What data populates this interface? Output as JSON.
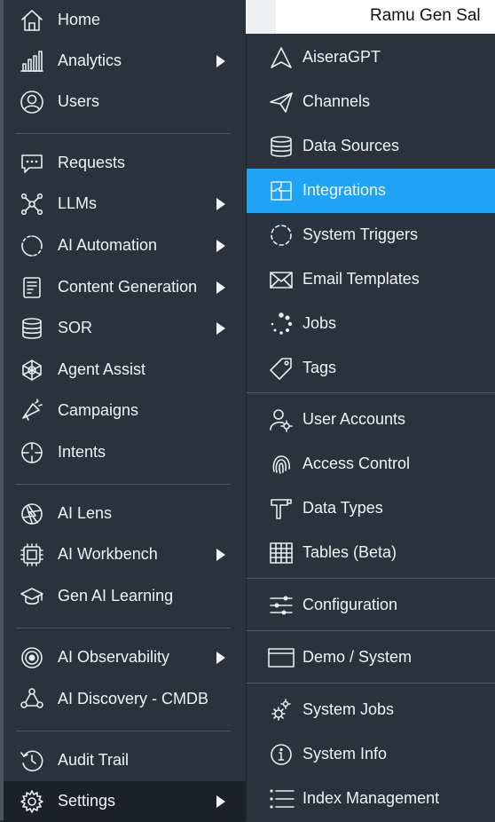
{
  "header": {
    "user_name": "Ramu Gen Sal"
  },
  "left_menu": {
    "items": [
      {
        "label": "Home",
        "icon": "home-icon",
        "has_submenu": false
      },
      {
        "label": "Analytics",
        "icon": "bar-chart-icon",
        "has_submenu": true
      },
      {
        "label": "Users",
        "icon": "user-circle-icon",
        "has_submenu": false
      },
      {
        "label": "Requests",
        "icon": "chat-bubble-icon",
        "has_submenu": false
      },
      {
        "label": "LLMs",
        "icon": "network-icon",
        "has_submenu": true
      },
      {
        "label": "AI Automation",
        "icon": "circle-dots-icon",
        "has_submenu": true
      },
      {
        "label": "Content Generation",
        "icon": "document-icon",
        "has_submenu": true
      },
      {
        "label": "SOR",
        "icon": "database-icon",
        "has_submenu": true
      },
      {
        "label": "Agent Assist",
        "icon": "web-icon",
        "has_submenu": false
      },
      {
        "label": "Campaigns",
        "icon": "megaphone-icon",
        "has_submenu": false
      },
      {
        "label": "Intents",
        "icon": "crosshair-icon",
        "has_submenu": false
      },
      {
        "label": "AI Lens",
        "icon": "aperture-icon",
        "has_submenu": false
      },
      {
        "label": "AI Workbench",
        "icon": "ai-chip-icon",
        "has_submenu": true
      },
      {
        "label": "Gen AI Learning",
        "icon": "graduation-cap-icon",
        "has_submenu": false
      },
      {
        "label": "AI Observability",
        "icon": "target-icon",
        "has_submenu": true
      },
      {
        "label": "AI Discovery - CMDB",
        "icon": "nodes-icon",
        "has_submenu": false
      },
      {
        "label": "Audit Trail",
        "icon": "history-icon",
        "has_submenu": false
      },
      {
        "label": "Settings",
        "icon": "gear-icon",
        "has_submenu": true,
        "active": true
      }
    ]
  },
  "settings_submenu": {
    "items": [
      {
        "label": "AiseraGPT",
        "icon": "arrow-nav-icon"
      },
      {
        "label": "Channels",
        "icon": "paper-plane-icon"
      },
      {
        "label": "Data Sources",
        "icon": "database-icon"
      },
      {
        "label": "Integrations",
        "icon": "puzzle-icon",
        "active": true
      },
      {
        "label": "System Triggers",
        "icon": "dashed-circle-icon"
      },
      {
        "label": "Email Templates",
        "icon": "envelope-icon"
      },
      {
        "label": "Jobs",
        "icon": "spinner-icon"
      },
      {
        "label": "Tags",
        "icon": "tag-icon"
      },
      {
        "label": "User Accounts",
        "icon": "user-gear-icon"
      },
      {
        "label": "Access Control",
        "icon": "fingerprint-icon"
      },
      {
        "label": "Data Types",
        "icon": "type-icon"
      },
      {
        "label": "Tables (Beta)",
        "icon": "table-icon"
      },
      {
        "label": "Configuration",
        "icon": "sliders-icon"
      },
      {
        "label": "Demo / System",
        "icon": "window-icon"
      },
      {
        "label": "System Jobs",
        "icon": "gears-icon"
      },
      {
        "label": "System Info",
        "icon": "info-icon"
      },
      {
        "label": "Index Management",
        "icon": "list-icon"
      }
    ]
  },
  "colors": {
    "panel": "#2a323d",
    "active_left": "#1c2129",
    "accent": "#1fa3f4",
    "text": "#f1f3f6"
  }
}
